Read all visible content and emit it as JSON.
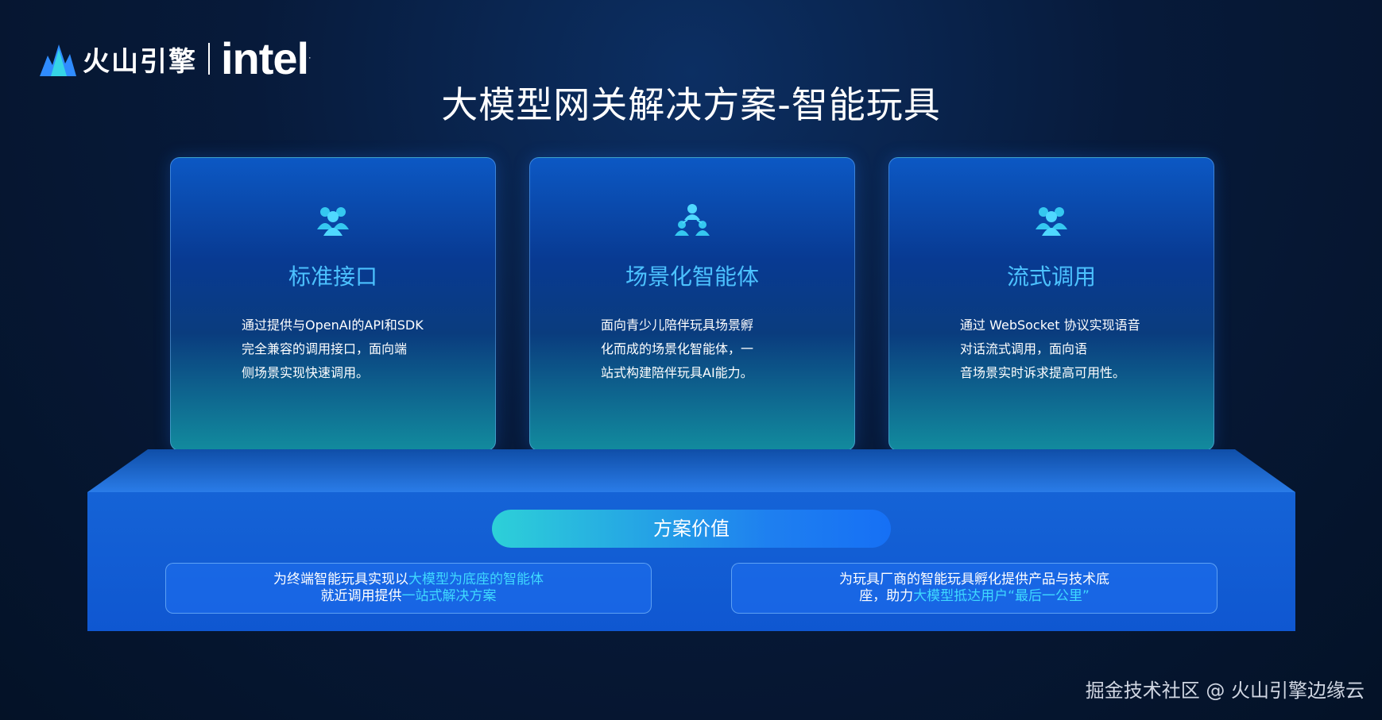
{
  "logo": {
    "brand_cn": "火山引擎",
    "brand_intel": "intel",
    "trademark": "."
  },
  "title": "大模型网关解决方案-智能玩具",
  "cards": [
    {
      "icon": "group-icon",
      "title": "标准接口",
      "desc": [
        "通过提供与OpenAI的API和SDK",
        "完全兼容的调用接口，面向端",
        "侧场景实现快速调用。"
      ]
    },
    {
      "icon": "network-icon",
      "title": "场景化智能体",
      "desc": [
        "面向青少儿陪伴玩具场景孵",
        "化而成的场景化智能体，一",
        "站式构建陪伴玩具AI能力。"
      ]
    },
    {
      "icon": "group-icon",
      "title": "流式调用",
      "desc": [
        "通过 WebSocket 协议实现语音",
        "对话流式调用，面向语",
        "音场景实时诉求提高可用性。"
      ]
    }
  ],
  "value": {
    "label": "方案价值",
    "left": {
      "line1_a": "为终端智能玩具实现以",
      "line1_b": "大模型为底座的智能体",
      "line2_a": "就近调用提供",
      "line2_b": "一站式解决方案"
    },
    "right": {
      "line1": "为玩具厂商的智能玩具孵化提供产品与技术底",
      "line2_a": "座，助力",
      "line2_b": "大模型抵达用户“最后一公里”"
    }
  },
  "footer": "掘金技术社区 @ 火山引擎边缘云",
  "colors": {
    "accent": "#4cc2ff",
    "highlight": "#3fd9ff",
    "platform": "#1563d6"
  }
}
